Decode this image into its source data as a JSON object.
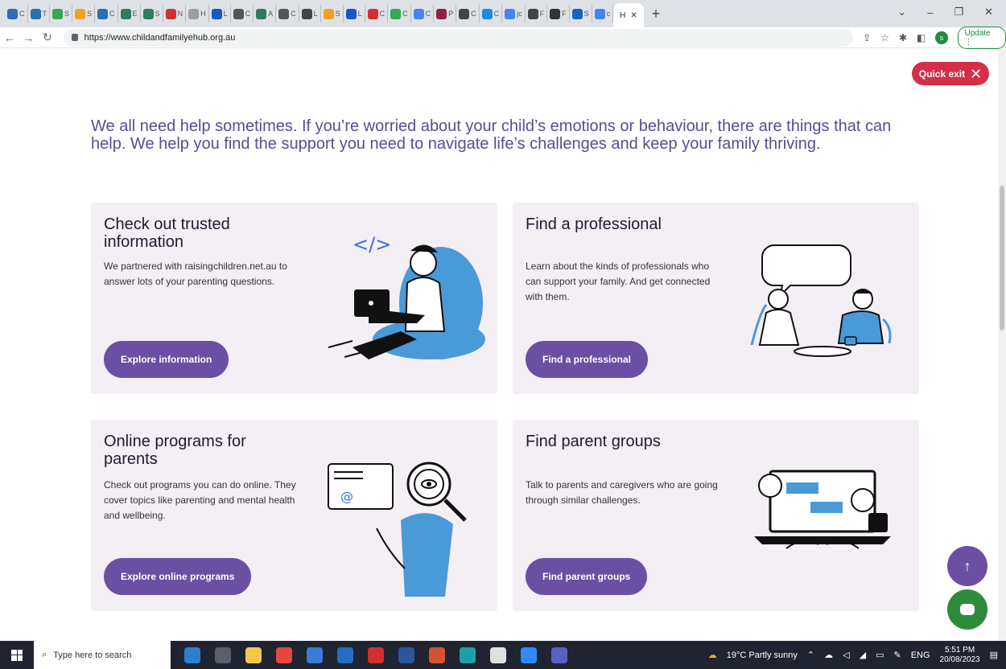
{
  "browser": {
    "active_tab_label": "H",
    "url": "https://www.childandfamilyehub.org.au",
    "update_label": "Update",
    "profile_initial": "s",
    "mini_tabs": [
      {
        "label": "C",
        "color": "#2b6fb6"
      },
      {
        "label": "T",
        "color": "#2b6fb6"
      },
      {
        "label": "S",
        "color": "#3aa757"
      },
      {
        "label": "S",
        "color": "#f4a024"
      },
      {
        "label": "C",
        "color": "#2b6fb6"
      },
      {
        "label": "E",
        "color": "#2e7d5b"
      },
      {
        "label": "S",
        "color": "#2e7d5b"
      },
      {
        "label": "N",
        "color": "#d32f2f"
      },
      {
        "label": "H",
        "color": "#9e9e9e"
      },
      {
        "label": "L",
        "color": "#1a56c4"
      },
      {
        "label": "C",
        "color": "#555555"
      },
      {
        "label": "A",
        "color": "#2e7d5b"
      },
      {
        "label": "C",
        "color": "#555555"
      },
      {
        "label": "L",
        "color": "#444444"
      },
      {
        "label": "S",
        "color": "#f4a024"
      },
      {
        "label": "L",
        "color": "#1a56c4"
      },
      {
        "label": "C",
        "color": "#d32f2f"
      },
      {
        "label": "C",
        "color": "#34a853"
      },
      {
        "label": "C",
        "color": "#4285f4"
      },
      {
        "label": "P",
        "color": "#8e2440"
      },
      {
        "label": "C",
        "color": "#444444"
      },
      {
        "label": "C",
        "color": "#1e88e5"
      },
      {
        "label": "jc",
        "color": "#4285f4"
      },
      {
        "label": "F",
        "color": "#444444"
      },
      {
        "label": "F",
        "color": "#333333"
      },
      {
        "label": "S",
        "color": "#1565c0"
      },
      {
        "label": "c",
        "color": "#4285f4"
      }
    ]
  },
  "page": {
    "quick_exit_label": "Quick exit",
    "intro": "We all need help sometimes. If you’re worried about your child’s emotions or behaviour, there are things that can help. We help you find the support you need to navigate life’s challenges and keep your family thriving.",
    "cards": [
      {
        "title": "Check out trusted information",
        "text": "We partnered with raisingchildren.net.au to answer lots of your parenting questions.",
        "button": "Explore information"
      },
      {
        "title": "Find a professional",
        "text": "Learn about the kinds of professionals who can support your family. And get connected with them.",
        "button": "Find a professional"
      },
      {
        "title": "Online programs for parents",
        "text": "Check out programs you can do online. They cover topics like parenting and mental health and wellbeing.",
        "button": "Explore online programs"
      },
      {
        "title": "Find parent groups",
        "text": "Talk to parents and caregivers who are going through similar challenges.",
        "button": "Find parent groups"
      }
    ],
    "code_glyph": "</>"
  },
  "taskbar": {
    "search_placeholder": "Type here to search",
    "weather": "19°C  Partly sunny",
    "language": "ENG",
    "time": "5:51 PM",
    "date": "20/08/2023",
    "apps": [
      {
        "name": "photos",
        "color": "#2a7fd4"
      },
      {
        "name": "task-view",
        "color": "#5a5f6b"
      },
      {
        "name": "file-explorer",
        "color": "#f2c94c"
      },
      {
        "name": "chrome",
        "color": "#e8453c"
      },
      {
        "name": "store",
        "color": "#3a7bd5"
      },
      {
        "name": "outlook",
        "color": "#1f6fc4"
      },
      {
        "name": "acrobat",
        "color": "#d32f2f"
      },
      {
        "name": "word",
        "color": "#2b579a"
      },
      {
        "name": "powerpoint",
        "color": "#d35230"
      },
      {
        "name": "edge",
        "color": "#1fa0a8"
      },
      {
        "name": "paint",
        "color": "#e0e0e0"
      },
      {
        "name": "zoom",
        "color": "#2d8cff"
      },
      {
        "name": "teams",
        "color": "#5b5fc7"
      }
    ]
  }
}
